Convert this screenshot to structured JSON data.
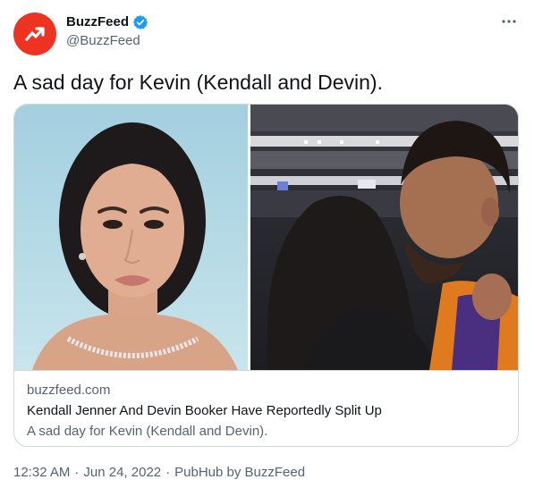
{
  "account": {
    "display_name": "BuzzFeed",
    "handle": "@BuzzFeed",
    "avatar_icon": "buzzfeed-trending-arrow-icon",
    "avatar_color": "#ee3322",
    "verified_icon": "verified-badge-icon",
    "verified_color": "#1d9bf0"
  },
  "more_icon": "more-options-icon",
  "tweet": {
    "text": "A sad day for Kevin (Kendall and Devin)."
  },
  "card": {
    "domain": "buzzfeed.com",
    "title": "Kendall Jenner And Devin Booker Have Reportedly Split Up",
    "description": "A sad day for Kevin (Kendall and Devin)."
  },
  "footer": {
    "time": "12:32 AM",
    "separator": "·",
    "date": "Jun 24, 2022",
    "source": "PubHub by BuzzFeed"
  },
  "colors": {
    "text_primary": "#0f1419",
    "text_secondary": "#536471",
    "border": "#cfd9de"
  }
}
